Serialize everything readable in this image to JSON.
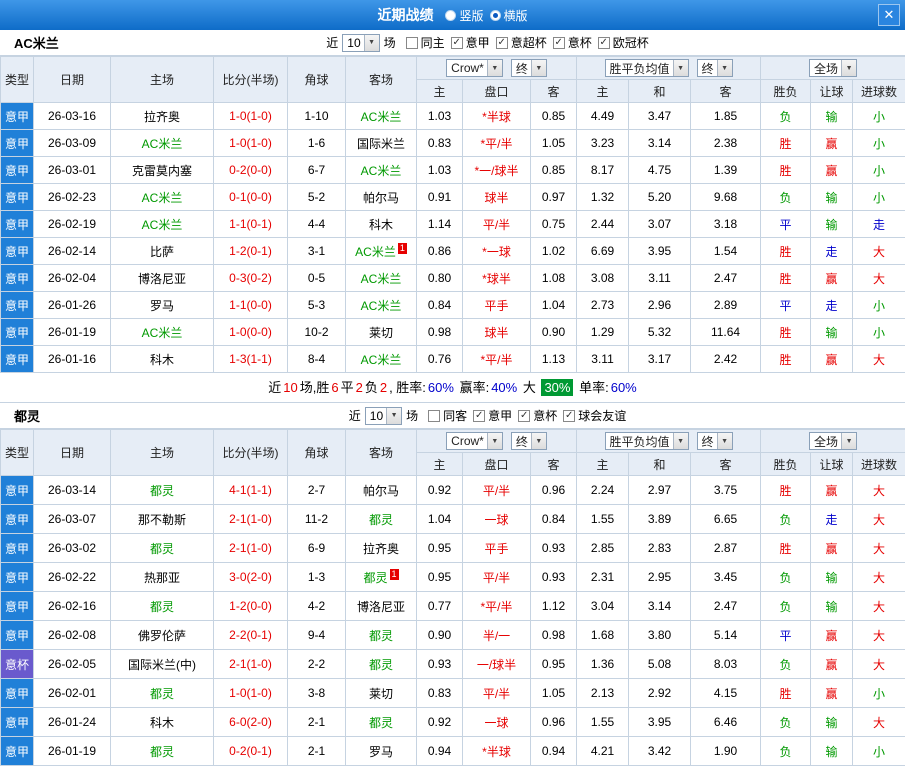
{
  "titlebar": {
    "title": "近期战绩",
    "radios": [
      {
        "label": "竖版",
        "selected": false
      },
      {
        "label": "横版",
        "selected": true
      }
    ],
    "close": "✕"
  },
  "labels": {
    "near": "近",
    "games": "场"
  },
  "icons": {
    "chevron_down": "▼",
    "check": "✓"
  },
  "colors": {
    "score": "#e60000",
    "handicap": "#e60000",
    "team_highlight": "#009900",
    "sup_bg": "#e60000",
    "sup_text": "1"
  },
  "league_colors": {
    "意甲": "#2080d8",
    "意杯": "#6a5acd"
  },
  "value_colors": {
    "胜": "#e60000",
    "赢": "#e60000",
    "大": "#e60000",
    "平": "#0000cc",
    "走": "#0000cc",
    "负": "#009900",
    "输": "#009900",
    "小": "#009900"
  },
  "table_header": {
    "cols": [
      "类型",
      "日期",
      "主场",
      "比分(半场)",
      "角球",
      "客场"
    ],
    "bookmaker": "Crow*",
    "final": "终",
    "avg_label": "胜平负均值",
    "final2": "终",
    "scope": "全场",
    "odds_sub": [
      "主",
      "盘口",
      "客"
    ],
    "avg_sub": [
      "主",
      "和",
      "客"
    ],
    "result_sub": [
      "胜负",
      "让球",
      "进球数"
    ]
  },
  "sections": [
    {
      "team": "AC米兰",
      "filter": {
        "count": "10",
        "checkboxes": [
          {
            "label": "同主",
            "checked": false
          },
          {
            "label": "意甲",
            "checked": true
          },
          {
            "label": "意超杯",
            "checked": true
          },
          {
            "label": "意杯",
            "checked": true
          },
          {
            "label": "欧冠杯",
            "checked": true
          }
        ]
      },
      "rows": [
        {
          "league": "意甲",
          "date": "26-03-16",
          "home": "拉齐奥",
          "score": "1-0(1-0)",
          "corner": "1-10",
          "away": "AC米兰",
          "o1": "1.03",
          "hcap": "*半球",
          "o2": "0.85",
          "a1": "4.49",
          "a2": "3.47",
          "a3": "1.85",
          "r1": "负",
          "r2": "输",
          "r3": "小",
          "sup": ""
        },
        {
          "league": "意甲",
          "date": "26-03-09",
          "home": "AC米兰",
          "score": "1-0(1-0)",
          "corner": "1-6",
          "away": "国际米兰",
          "o1": "0.83",
          "hcap": "*平/半",
          "o2": "1.05",
          "a1": "3.23",
          "a2": "3.14",
          "a3": "2.38",
          "r1": "胜",
          "r2": "赢",
          "r3": "小",
          "sup": ""
        },
        {
          "league": "意甲",
          "date": "26-03-01",
          "home": "克雷莫内塞",
          "score": "0-2(0-0)",
          "corner": "6-7",
          "away": "AC米兰",
          "o1": "1.03",
          "hcap": "*一/球半",
          "o2": "0.85",
          "a1": "8.17",
          "a2": "4.75",
          "a3": "1.39",
          "r1": "胜",
          "r2": "赢",
          "r3": "小",
          "sup": ""
        },
        {
          "league": "意甲",
          "date": "26-02-23",
          "home": "AC米兰",
          "score": "0-1(0-0)",
          "corner": "5-2",
          "away": "帕尔马",
          "o1": "0.91",
          "hcap": "球半",
          "o2": "0.97",
          "a1": "1.32",
          "a2": "5.20",
          "a3": "9.68",
          "r1": "负",
          "r2": "输",
          "r3": "小",
          "sup": ""
        },
        {
          "league": "意甲",
          "date": "26-02-19",
          "home": "AC米兰",
          "score": "1-1(0-1)",
          "corner": "4-4",
          "away": "科木",
          "o1": "1.14",
          "hcap": "平/半",
          "o2": "0.75",
          "a1": "2.44",
          "a2": "3.07",
          "a3": "3.18",
          "r1": "平",
          "r2": "输",
          "r3": "走",
          "sup": ""
        },
        {
          "league": "意甲",
          "date": "26-02-14",
          "home": "比萨",
          "score": "1-2(0-1)",
          "corner": "3-1",
          "away": "AC米兰",
          "o1": "0.86",
          "hcap": "*一球",
          "o2": "1.02",
          "a1": "6.69",
          "a2": "3.95",
          "a3": "1.54",
          "r1": "胜",
          "r2": "走",
          "r3": "大",
          "sup": "away"
        },
        {
          "league": "意甲",
          "date": "26-02-04",
          "home": "博洛尼亚",
          "score": "0-3(0-2)",
          "corner": "0-5",
          "away": "AC米兰",
          "o1": "0.80",
          "hcap": "*球半",
          "o2": "1.08",
          "a1": "3.08",
          "a2": "3.11",
          "a3": "2.47",
          "r1": "胜",
          "r2": "赢",
          "r3": "大",
          "sup": ""
        },
        {
          "league": "意甲",
          "date": "26-01-26",
          "home": "罗马",
          "score": "1-1(0-0)",
          "corner": "5-3",
          "away": "AC米兰",
          "o1": "0.84",
          "hcap": "平手",
          "o2": "1.04",
          "a1": "2.73",
          "a2": "2.96",
          "a3": "2.89",
          "r1": "平",
          "r2": "走",
          "r3": "小",
          "sup": ""
        },
        {
          "league": "意甲",
          "date": "26-01-19",
          "home": "AC米兰",
          "score": "1-0(0-0)",
          "corner": "10-2",
          "away": "莱切",
          "o1": "0.98",
          "hcap": "球半",
          "o2": "0.90",
          "a1": "1.29",
          "a2": "5.32",
          "a3": "11.64",
          "r1": "胜",
          "r2": "输",
          "r3": "小",
          "sup": ""
        },
        {
          "league": "意甲",
          "date": "26-01-16",
          "home": "科木",
          "score": "1-3(1-1)",
          "corner": "8-4",
          "away": "AC米兰",
          "o1": "0.76",
          "hcap": "*平/半",
          "o2": "1.13",
          "a1": "3.11",
          "a2": "3.17",
          "a3": "2.42",
          "r1": "胜",
          "r2": "赢",
          "r3": "大",
          "sup": ""
        }
      ],
      "summary": [
        {
          "t": "近",
          "c": "#000000"
        },
        {
          "t": "10",
          "c": "#e60000"
        },
        {
          "t": "场,胜",
          "c": "#000000"
        },
        {
          "t": "6",
          "c": "#e60000"
        },
        {
          "t": "平",
          "c": "#000000"
        },
        {
          "t": "2",
          "c": "#e60000"
        },
        {
          "t": "负",
          "c": "#000000"
        },
        {
          "t": "2",
          "c": "#e60000"
        },
        {
          "t": ", 胜率:",
          "c": "#000000"
        },
        {
          "t": "60%",
          "c": "#0000cc"
        },
        {
          "t": " 赢率:",
          "c": "#000000"
        },
        {
          "t": "40%",
          "c": "#0000cc"
        },
        {
          "t": " 大 ",
          "c": "#000000"
        },
        {
          "t": "30%",
          "c": "#ffffff",
          "bg": "#009933"
        },
        {
          "t": " 单率:",
          "c": "#000000"
        },
        {
          "t": "60%",
          "c": "#0000cc"
        }
      ]
    },
    {
      "team": "都灵",
      "filter": {
        "count": "10",
        "checkboxes": [
          {
            "label": "同客",
            "checked": false
          },
          {
            "label": "意甲",
            "checked": true
          },
          {
            "label": "意杯",
            "checked": true
          },
          {
            "label": "球会友谊",
            "checked": true
          }
        ]
      },
      "rows": [
        {
          "league": "意甲",
          "date": "26-03-14",
          "home": "都灵",
          "score": "4-1(1-1)",
          "corner": "2-7",
          "away": "帕尔马",
          "o1": "0.92",
          "hcap": "平/半",
          "o2": "0.96",
          "a1": "2.24",
          "a2": "2.97",
          "a3": "3.75",
          "r1": "胜",
          "r2": "赢",
          "r3": "大",
          "sup": ""
        },
        {
          "league": "意甲",
          "date": "26-03-07",
          "home": "那不勒斯",
          "score": "2-1(1-0)",
          "corner": "11-2",
          "away": "都灵",
          "o1": "1.04",
          "hcap": "一球",
          "o2": "0.84",
          "a1": "1.55",
          "a2": "3.89",
          "a3": "6.65",
          "r1": "负",
          "r2": "走",
          "r3": "大",
          "sup": ""
        },
        {
          "league": "意甲",
          "date": "26-03-02",
          "home": "都灵",
          "score": "2-1(1-0)",
          "corner": "6-9",
          "away": "拉齐奥",
          "o1": "0.95",
          "hcap": "平手",
          "o2": "0.93",
          "a1": "2.85",
          "a2": "2.83",
          "a3": "2.87",
          "r1": "胜",
          "r2": "赢",
          "r3": "大",
          "sup": ""
        },
        {
          "league": "意甲",
          "date": "26-02-22",
          "home": "热那亚",
          "score": "3-0(2-0)",
          "corner": "1-3",
          "away": "都灵",
          "o1": "0.95",
          "hcap": "平/半",
          "o2": "0.93",
          "a1": "2.31",
          "a2": "2.95",
          "a3": "3.45",
          "r1": "负",
          "r2": "输",
          "r3": "大",
          "sup": "away"
        },
        {
          "league": "意甲",
          "date": "26-02-16",
          "home": "都灵",
          "score": "1-2(0-0)",
          "corner": "4-2",
          "away": "博洛尼亚",
          "o1": "0.77",
          "hcap": "*平/半",
          "o2": "1.12",
          "a1": "3.04",
          "a2": "3.14",
          "a3": "2.47",
          "r1": "负",
          "r2": "输",
          "r3": "大",
          "sup": ""
        },
        {
          "league": "意甲",
          "date": "26-02-08",
          "home": "佛罗伦萨",
          "score": "2-2(0-1)",
          "corner": "9-4",
          "away": "都灵",
          "o1": "0.90",
          "hcap": "半/一",
          "o2": "0.98",
          "a1": "1.68",
          "a2": "3.80",
          "a3": "5.14",
          "r1": "平",
          "r2": "赢",
          "r3": "大",
          "sup": ""
        },
        {
          "league": "意杯",
          "date": "26-02-05",
          "home": "国际米兰(中)",
          "score": "2-1(1-0)",
          "corner": "2-2",
          "away": "都灵",
          "o1": "0.93",
          "hcap": "一/球半",
          "o2": "0.95",
          "a1": "1.36",
          "a2": "5.08",
          "a3": "8.03",
          "r1": "负",
          "r2": "赢",
          "r3": "大",
          "sup": ""
        },
        {
          "league": "意甲",
          "date": "26-02-01",
          "home": "都灵",
          "score": "1-0(1-0)",
          "corner": "3-8",
          "away": "莱切",
          "o1": "0.83",
          "hcap": "平/半",
          "o2": "1.05",
          "a1": "2.13",
          "a2": "2.92",
          "a3": "4.15",
          "r1": "胜",
          "r2": "赢",
          "r3": "小",
          "sup": ""
        },
        {
          "league": "意甲",
          "date": "26-01-24",
          "home": "科木",
          "score": "6-0(2-0)",
          "corner": "2-1",
          "away": "都灵",
          "o1": "0.92",
          "hcap": "一球",
          "o2": "0.96",
          "a1": "1.55",
          "a2": "3.95",
          "a3": "6.46",
          "r1": "负",
          "r2": "输",
          "r3": "大",
          "sup": ""
        },
        {
          "league": "意甲",
          "date": "26-01-19",
          "home": "都灵",
          "score": "0-2(0-1)",
          "corner": "2-1",
          "away": "罗马",
          "o1": "0.94",
          "hcap": "*半球",
          "o2": "0.94",
          "a1": "4.21",
          "a2": "3.42",
          "a3": "1.90",
          "r1": "负",
          "r2": "输",
          "r3": "小",
          "sup": ""
        }
      ]
    }
  ]
}
